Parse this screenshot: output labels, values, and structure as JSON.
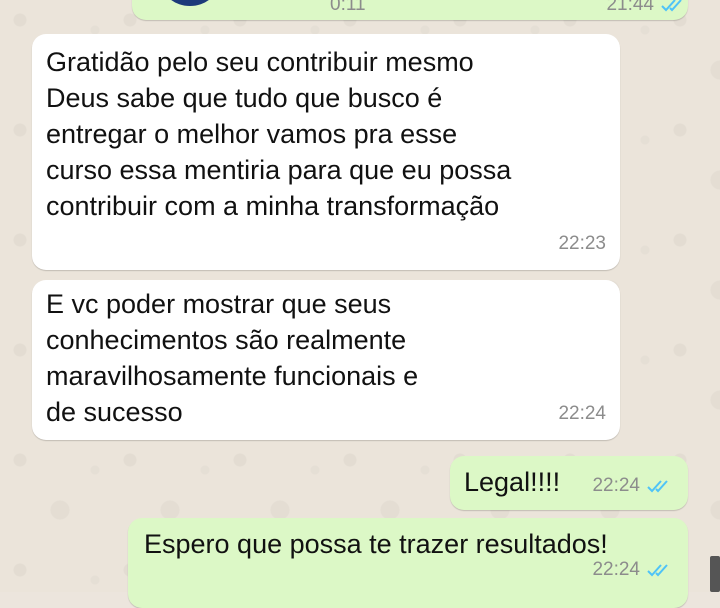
{
  "chat": {
    "top_partial": {
      "left_time": "0:11",
      "right_time": "21:44"
    },
    "messages": [
      {
        "direction": "incoming",
        "lines": [
          "Gratidão pelo seu contribuir mesmo",
          "Deus sabe que tudo que busco é",
          "entregar o melhor vamos pra esse",
          "curso essa mentiria para que eu possa",
          "contribuir com a minha transformação"
        ],
        "time": "22:23"
      },
      {
        "direction": "incoming",
        "lines": [
          "E vc poder mostrar que seus",
          "conhecimentos são realmente",
          "maravilhosamente funcionais e",
          "de sucesso"
        ],
        "time": "22:24"
      },
      {
        "direction": "outgoing",
        "text": "Legal!!!!",
        "time": "22:24",
        "status_icon": "double-check-read-icon"
      },
      {
        "direction": "outgoing",
        "text": "Espero que possa te trazer resultados!",
        "time": "22:24",
        "status_icon": "double-check-read-icon"
      }
    ]
  },
  "colors": {
    "incoming_bubble": "#ffffff",
    "outgoing_bubble": "#dcf8c6",
    "read_tick": "#4fc3f7",
    "timestamp": "#8c8c8c",
    "wallpaper": "#ebe4da"
  }
}
